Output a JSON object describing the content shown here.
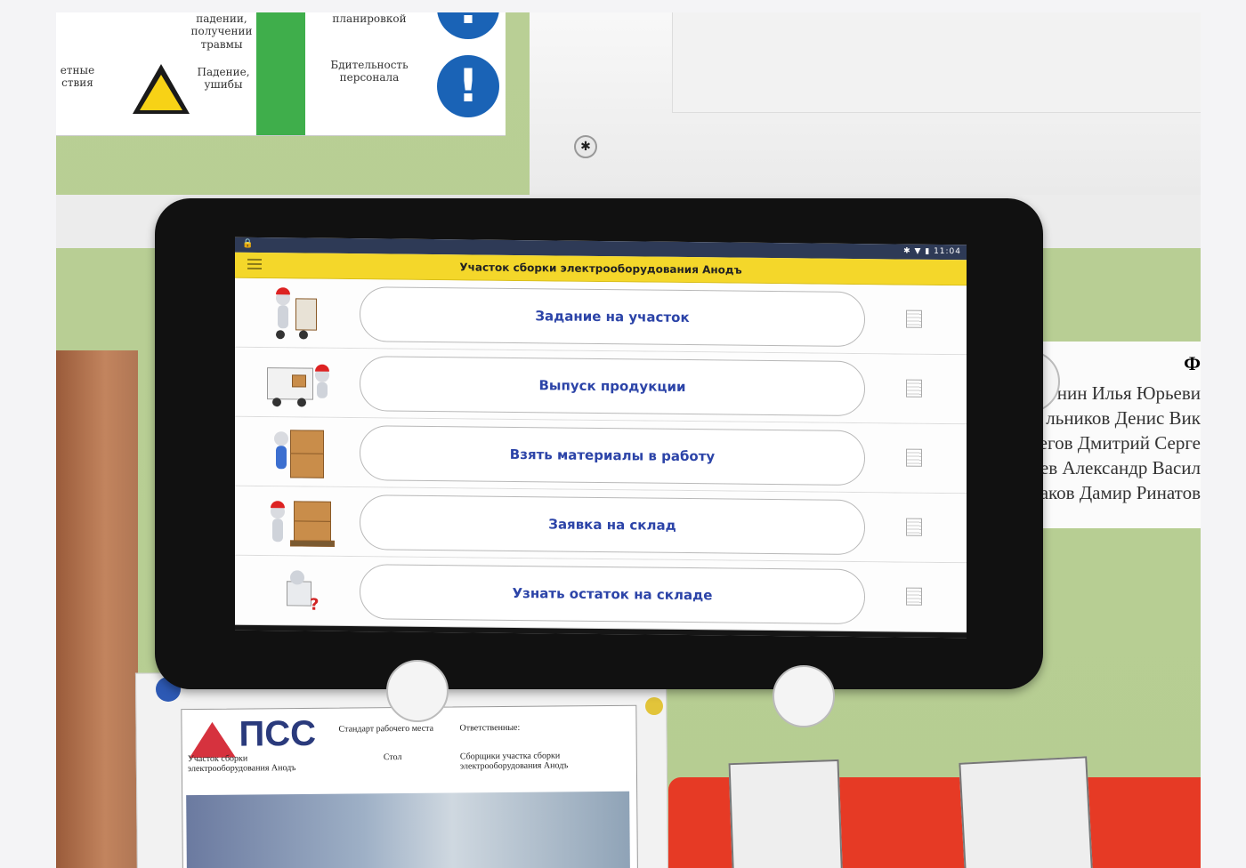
{
  "statusbar": {
    "time": "11:04"
  },
  "appbar": {
    "title": "Участок сборки электрооборудования Анодъ"
  },
  "menu_items": [
    {
      "label": "Задание на участок"
    },
    {
      "label": "Выпуск продукции"
    },
    {
      "label": "Взять материалы в работу"
    },
    {
      "label": "Заявка на склад"
    },
    {
      "label": "Узнать остаток на складе"
    }
  ],
  "navbar": {
    "back": "◁",
    "home": "○",
    "recents": "□"
  },
  "background": {
    "safety_sheet": {
      "cells": [
        "падении, получении травмы",
        "Падение, ушибы",
        "Бдительность персонала",
        "планировкой",
        "етные ствия"
      ]
    },
    "names_board": {
      "heading": "Ф",
      "lines": [
        "нин Илья Юрьеви",
        "льников Денис Вик",
        "егов Дмитрий Серге",
        "нев Александр Васил",
        "таков Дамир Ринатов"
      ]
    },
    "pss_sheet": {
      "logo": "ПСС",
      "standard": "Стандарт рабочего места",
      "responsible": "Ответственные:",
      "area": "Участок сборки электрооборудования Анодъ",
      "table": "Стол",
      "assemblers": "Сборщики участка сборки электрооборудования Анодъ"
    }
  },
  "colors": {
    "appbar": "#f4d72a",
    "button_text": "#2c44a8",
    "statusbar": "#2e3a56"
  }
}
